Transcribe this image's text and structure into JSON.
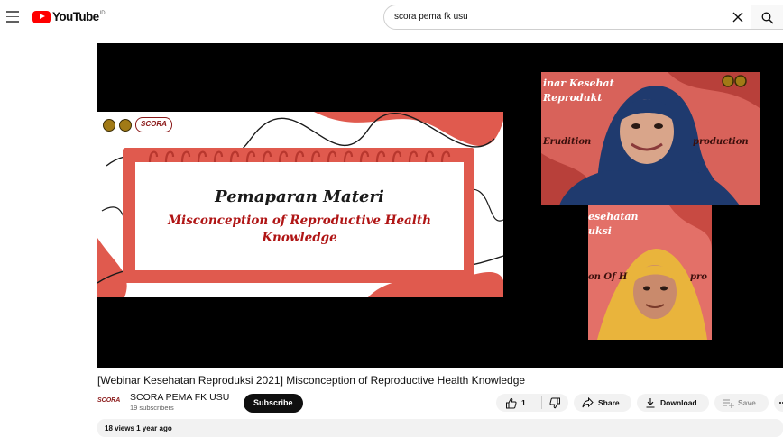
{
  "header": {
    "logo_text": "YouTube",
    "region_code": "ID",
    "search_value": "scora pema fk usu",
    "icons": [
      "menu-icon",
      "youtube-play-icon",
      "close-icon",
      "search-icon"
    ]
  },
  "video": {
    "slide": {
      "logo_text": "SCORA",
      "heading": "Pemaparan Materi",
      "subtitle": "Misconception of Reproductive Health Knowledge"
    },
    "camera_1": {
      "background_text_top": "inar Kesehat",
      "background_text_mid": "Reprodukt",
      "background_text_row": "Erudition",
      "background_text_row_right": "production"
    },
    "camera_2": {
      "background_text_top": "esehatan",
      "background_text_mid": "uksi",
      "background_text_row": "on Of H",
      "background_text_row_right": "pro"
    }
  },
  "details": {
    "title": "[Webinar Kesehatan Reproduksi 2021] Misconception of Reproductive Health Knowledge",
    "channel_avatar_text": "SCORA",
    "channel_name": "SCORA PEMA FK USU",
    "subscribers": "19 subscribers",
    "subscribe_label": "Subscribe",
    "like_count": "1",
    "share_label": "Share",
    "download_label": "Download",
    "save_label": "Save",
    "description_preview": "18 views 1 year ago"
  },
  "colors": {
    "brand_red": "#ff0000",
    "slide_red": "#e05a4e",
    "subtitle_red": "#b01515"
  }
}
